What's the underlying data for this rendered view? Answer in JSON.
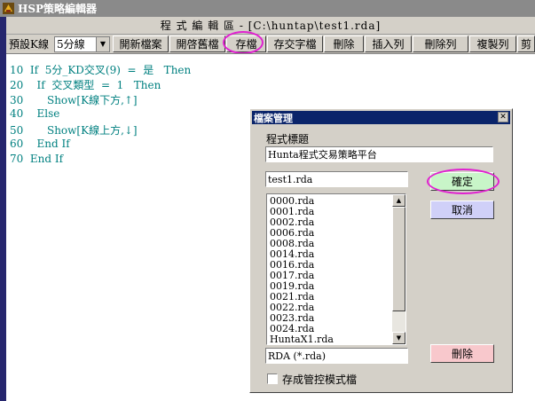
{
  "app": {
    "title": "HSP策略編輯器"
  },
  "document": {
    "title": "程 式 編 輯 區 - [C:\\huntap\\test1.rda]"
  },
  "toolbar": {
    "kline_label": "預設K線",
    "kline_select": "5分線",
    "new_label": "開新檔案",
    "open_label": "開啓舊檔",
    "save_label": "存檔",
    "save_as_label": "存交字檔",
    "delete_label": "刪除",
    "insert_row_label": "插入列",
    "delete_row_label": "刪除列",
    "copy_row_label": "複製列",
    "cut_off_label": "剪"
  },
  "code_lines": [
    {
      "text": "10  If  5分_KD交叉(9)  =  是   Then"
    },
    {
      "text": "20    If  交叉類型  =  1   Then"
    },
    {
      "text": "30       Show[K線下方,↑]"
    },
    {
      "text": "40    Else"
    },
    {
      "text": "50       Show[K線上方,↓]"
    },
    {
      "text": "60    End If"
    },
    {
      "text": "70  End If"
    }
  ],
  "dialog": {
    "title": "檔案管理",
    "program_title_label": "程式標題",
    "program_title_value": "Hunta程式交易策略平台",
    "filename_value": "test1.rda",
    "files": [
      "0000.rda",
      "0001.rda",
      "0002.rda",
      "0006.rda",
      "0008.rda",
      "0014.rda",
      "0016.rda",
      "0017.rda",
      "0019.rda",
      "0021.rda",
      "0022.rda",
      "0023.rda",
      "0024.rda",
      "HuntaX1.rda"
    ],
    "filter_value": "RDA (*.rda)",
    "ok_label": "確定",
    "cancel_label": "取消",
    "delete_label": "刪除",
    "checkbox_label": "存成管控模式檔"
  },
  "colors": {
    "code_text": "#008080",
    "highlight_ring": "#e020d0",
    "ok_button": "#c8f5c8",
    "cancel_button": "#d0d0f8",
    "delete_button": "#f8c8cc",
    "dialog_title_bg": "#0a246a"
  }
}
